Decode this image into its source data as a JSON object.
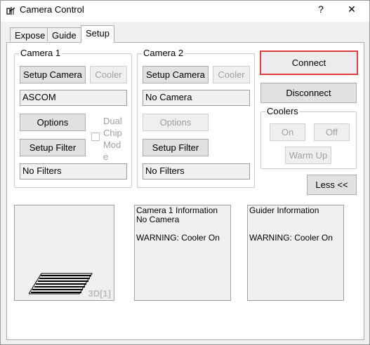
{
  "window": {
    "title": "Camera Control",
    "help_glyph": "?",
    "close_glyph": "✕"
  },
  "tabs": [
    {
      "label": "Expose"
    },
    {
      "label": "Guide"
    },
    {
      "label": "Setup"
    }
  ],
  "camera1": {
    "group_label": "Camera 1",
    "setup_camera": "Setup Camera",
    "cooler": "Cooler",
    "camera_name": "ASCOM",
    "options": "Options",
    "dual_chip_label_1": "Dual",
    "dual_chip_label_2": "Chip",
    "dual_chip_label_3": "Mod",
    "dual_chip_label_4": "e",
    "setup_filter": "Setup Filter",
    "filter_name": "No Filters"
  },
  "camera2": {
    "group_label": "Camera 2",
    "setup_camera": "Setup Camera",
    "cooler": "Cooler",
    "camera_name": "No Camera",
    "options": "Options",
    "setup_filter": "Setup Filter",
    "filter_name": "No Filters"
  },
  "connect": {
    "connect": "Connect",
    "disconnect": "Disconnect"
  },
  "coolers": {
    "group_label": "Coolers",
    "on": "On",
    "off": "Off",
    "warm_up": "Warm Up"
  },
  "less_button": "Less <<",
  "preview": {
    "label": "3D[1]"
  },
  "camera1_info": {
    "text": "Camera 1 Information\nNo Camera\n\nWARNING:  Cooler On"
  },
  "guider_info": {
    "text": "Guider Information\n\n\nWARNING:  Cooler On"
  }
}
